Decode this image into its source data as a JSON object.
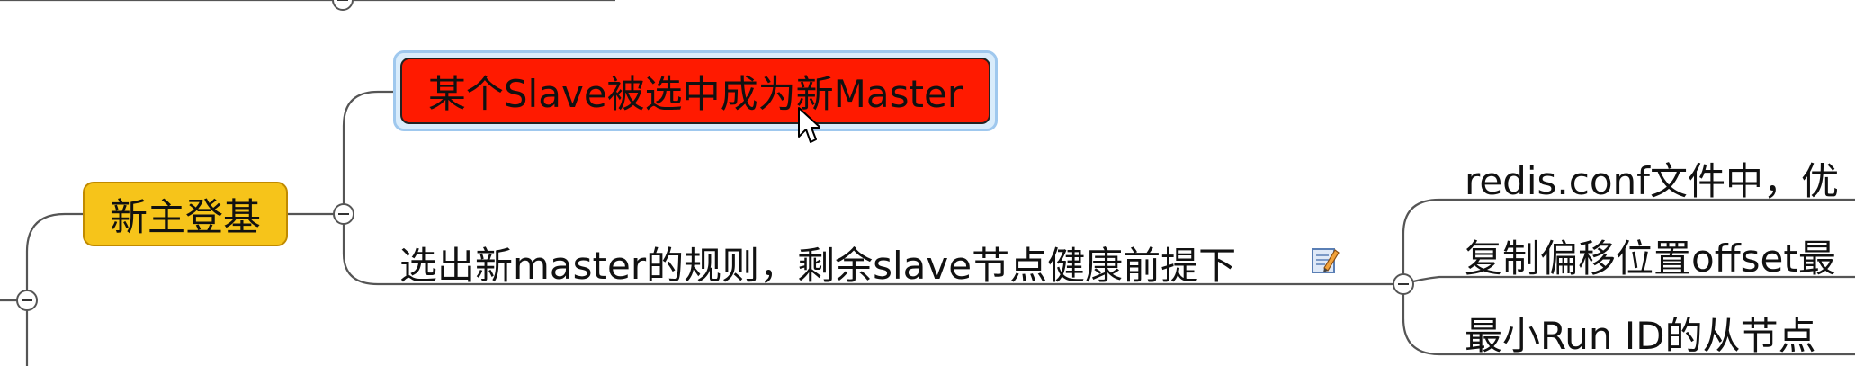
{
  "mindmap": {
    "main_topic": "新主登基",
    "selected_subtopic": "某个Slave被选中成为新Master",
    "rules_topic": "选出新master的规则，剩余slave节点健康前提下",
    "rules_children": [
      "redis.conf文件中，优",
      "复制偏移位置offset最",
      "最小Run ID的从节点"
    ]
  },
  "colors": {
    "main_topic_fill": "#f6c41a",
    "selected_fill": "#ff1a00",
    "selection_outline": "#9fc8ee",
    "connector": "#555555"
  }
}
